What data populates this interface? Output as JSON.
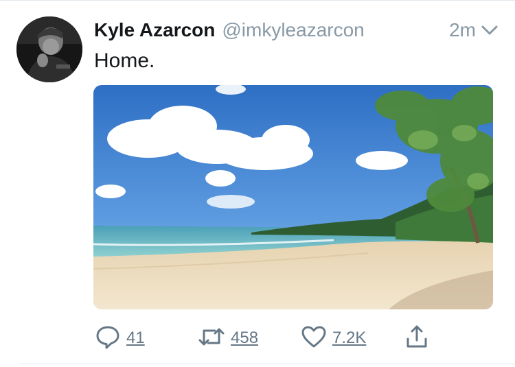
{
  "tweet": {
    "author_name": "Kyle Azarcon",
    "author_handle": "@imkyleazarcon",
    "timestamp": "2m",
    "text": "Home."
  },
  "actions": {
    "replies": "41",
    "retweets": "458",
    "likes": "7.2K"
  },
  "icons": {
    "reply": "reply-icon",
    "retweet": "retweet-icon",
    "like": "heart-icon",
    "share": "share-icon",
    "caret": "chevron-down-icon"
  },
  "colors": {
    "text": "#14171a",
    "secondary": "#8899a6",
    "action": "#657786",
    "divider": "#e1e8ed"
  }
}
